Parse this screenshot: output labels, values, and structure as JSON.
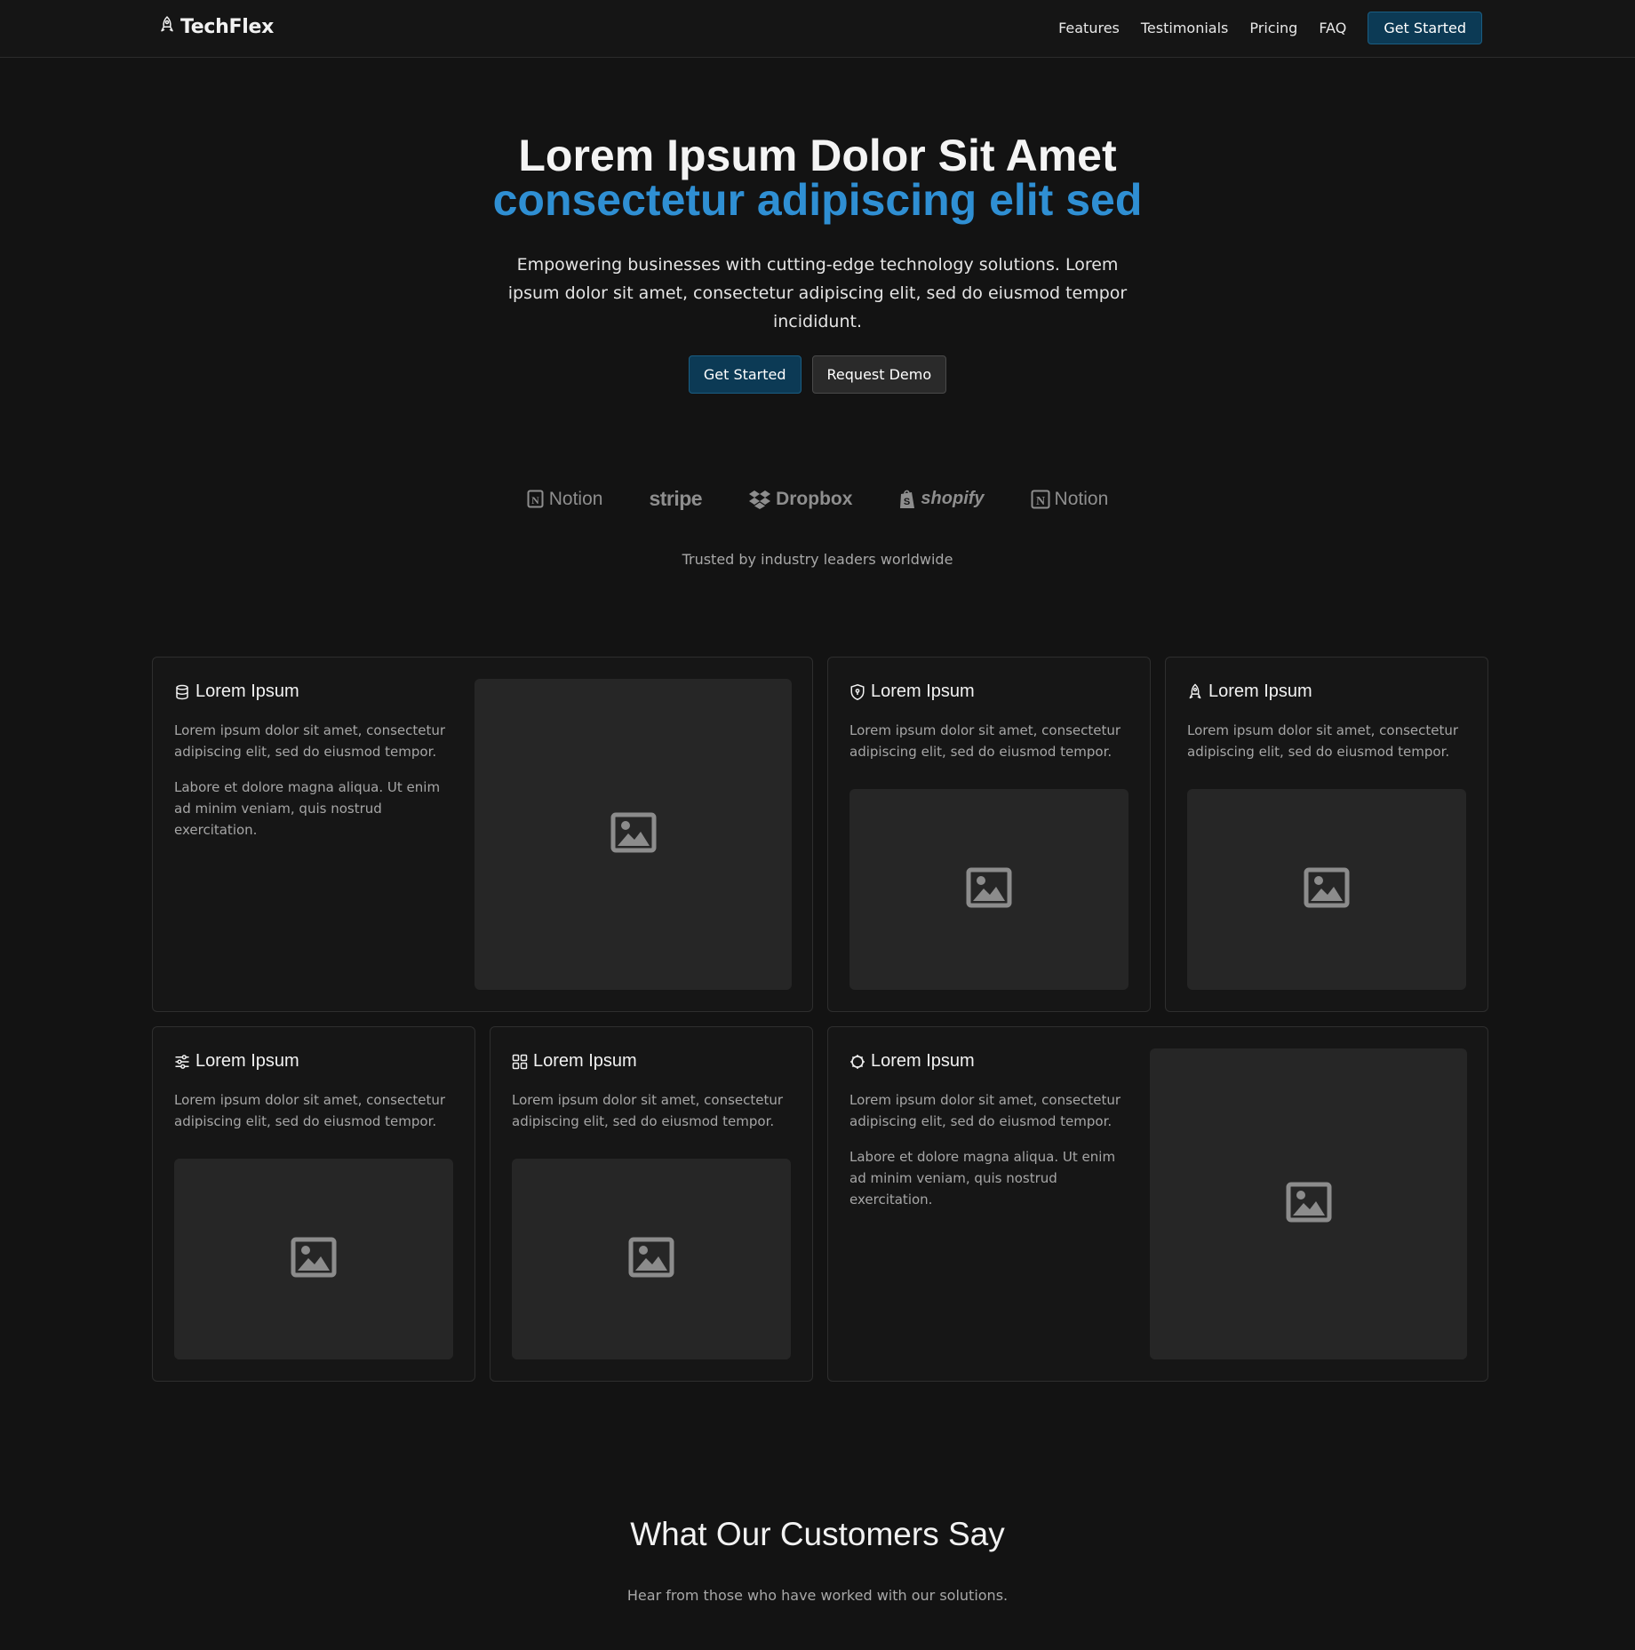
{
  "brand": {
    "name": "TechFlex",
    "icon": "rocket-icon"
  },
  "nav": {
    "links": [
      "Features",
      "Testimonials",
      "Pricing",
      "FAQ"
    ],
    "cta": "Get Started"
  },
  "hero": {
    "title_line1": "Lorem Ipsum Dolor Sit Amet",
    "title_line2": "consectetur adipiscing elit sed",
    "subtitle": "Empowering businesses with cutting-edge technology solutions. Lorem ipsum dolor sit amet, consectetur adipiscing elit, sed do eiusmod tempor incididunt.",
    "primary_button": "Get Started",
    "secondary_button": "Request Demo"
  },
  "logos": {
    "items": [
      "Notion",
      "stripe",
      "Dropbox",
      "shopify",
      "Notion"
    ],
    "caption": "Trusted by industry leaders worldwide"
  },
  "features": [
    {
      "icon": "database-icon",
      "title": "Lorem Ipsum",
      "text": "Lorem ipsum dolor sit amet, consectetur adipiscing elit, sed do eiusmod tempor.",
      "text2": "Labore et dolore magna aliqua. Ut enim ad minim veniam, quis nostrud exercitation."
    },
    {
      "icon": "shield-icon",
      "title": "Lorem Ipsum",
      "text": "Lorem ipsum dolor sit amet, consectetur adipiscing elit, sed do eiusmod tempor."
    },
    {
      "icon": "rocket-icon",
      "title": "Lorem Ipsum",
      "text": "Lorem ipsum dolor sit amet, consectetur adipiscing elit, sed do eiusmod tempor."
    },
    {
      "icon": "sliders-icon",
      "title": "Lorem Ipsum",
      "text": "Lorem ipsum dolor sit amet, consectetur adipiscing elit, sed do eiusmod tempor."
    },
    {
      "icon": "grid-icon",
      "title": "Lorem Ipsum",
      "text": "Lorem ipsum dolor sit amet, consectetur adipiscing elit, sed do eiusmod tempor."
    },
    {
      "icon": "gear-icon",
      "title": "Lorem Ipsum",
      "text": "Lorem ipsum dolor sit amet, consectetur adipiscing elit, sed do eiusmod tempor.",
      "text2": "Labore et dolore magna aliqua. Ut enim ad minim veniam, quis nostrud exercitation."
    }
  ],
  "testimonials": {
    "heading": "What Our Customers Say",
    "subheading": "Hear from those who have worked with our solutions."
  },
  "colors": {
    "background": "#131313",
    "accent_blue": "#2f8fd3",
    "button_primary": "#0c3a55",
    "card_bg": "#161616",
    "placeholder_bg": "#262626"
  }
}
